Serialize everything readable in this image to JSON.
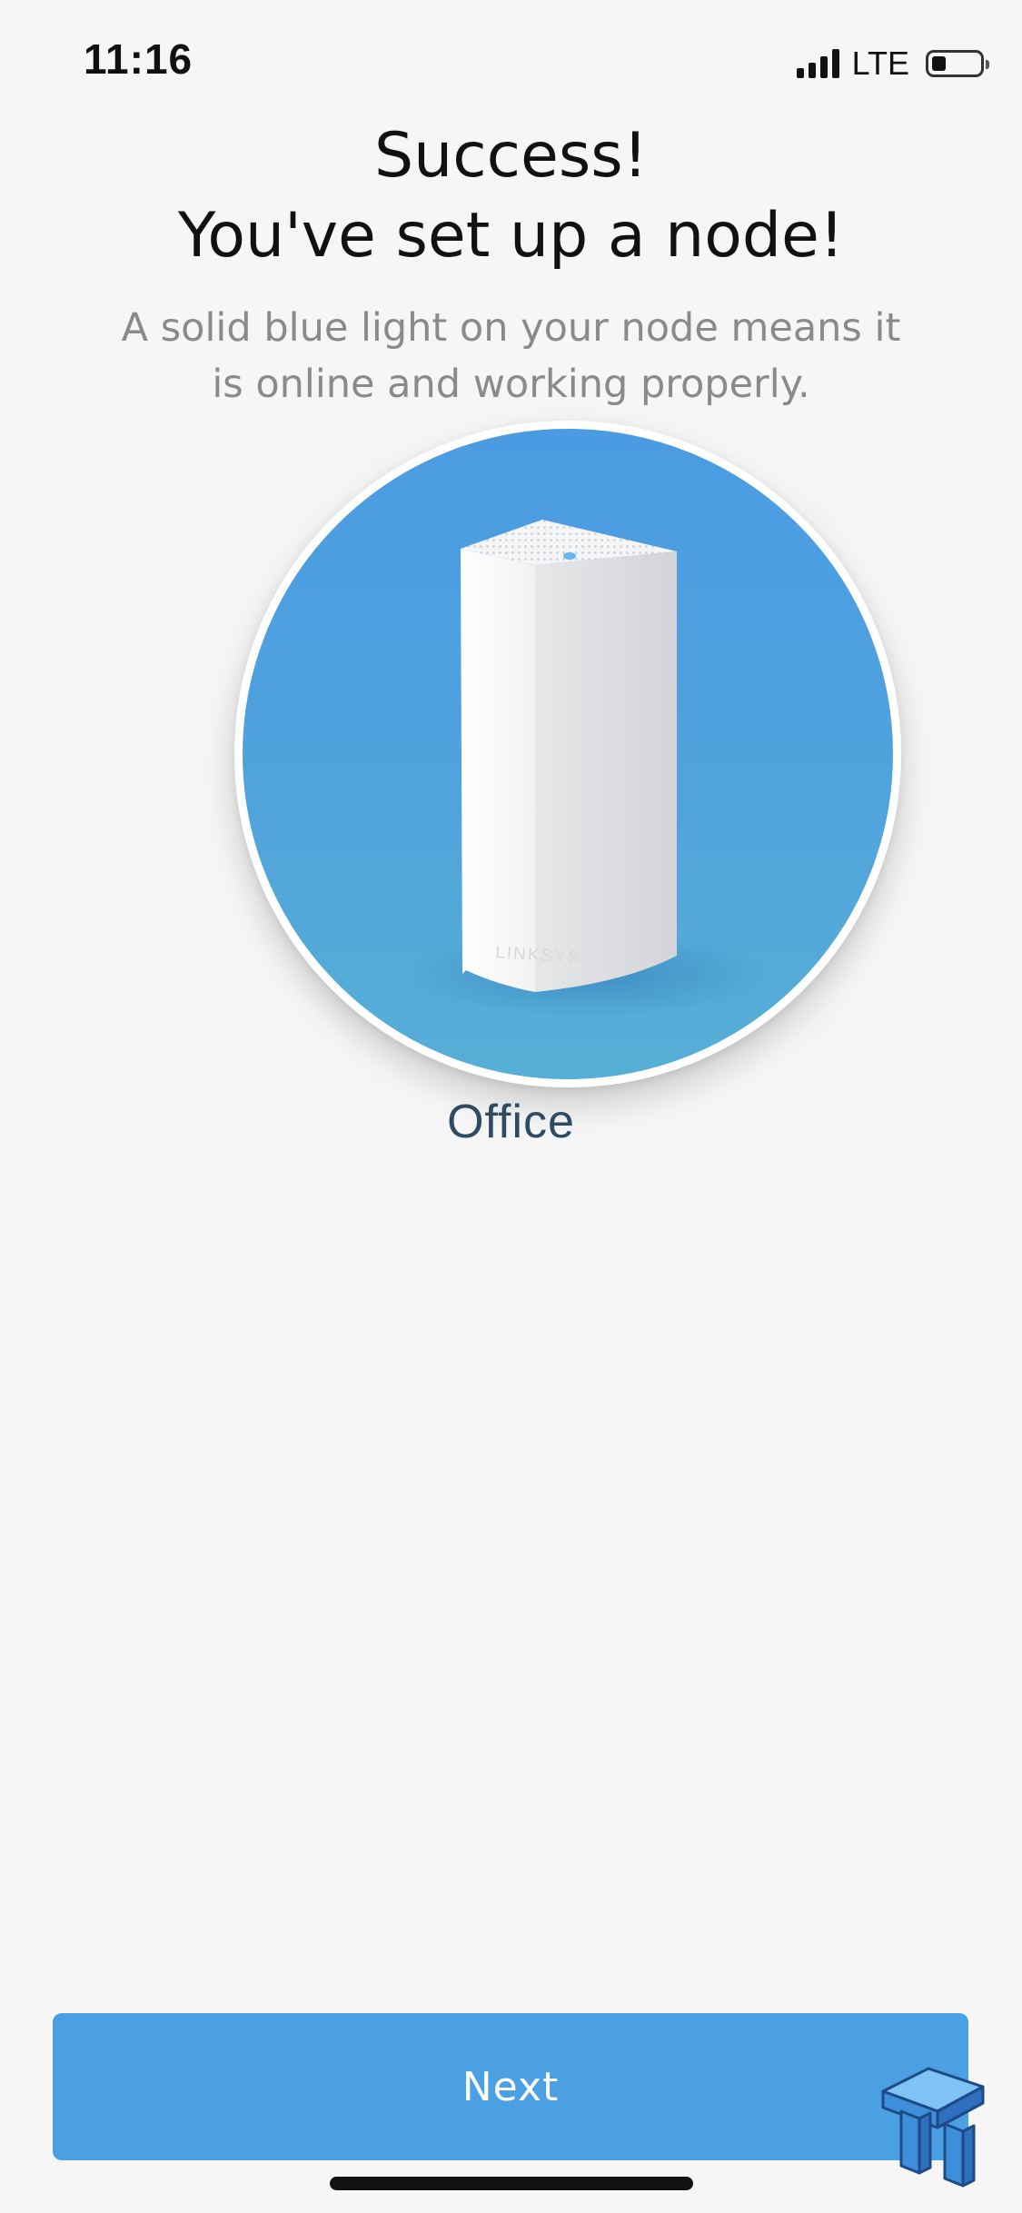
{
  "status_bar": {
    "time": "11:16",
    "network": "LTE",
    "battery_level": 0.3
  },
  "header": {
    "title_line1": "Success!",
    "title_line2": "You've set up a node!",
    "description": "A solid blue light on your node means it is online and working properly."
  },
  "node": {
    "name": "Office",
    "brand_mark": "LINKSYS",
    "icon": "mesh-node-icon"
  },
  "actions": {
    "next_label": "Next"
  },
  "colors": {
    "accent": "#4aa0e3",
    "circle_top": "#4b9be3",
    "circle_bottom": "#56afd6",
    "node_label": "#2f4a63",
    "description": "#8a8a8a",
    "background": "#f6f6f6"
  }
}
